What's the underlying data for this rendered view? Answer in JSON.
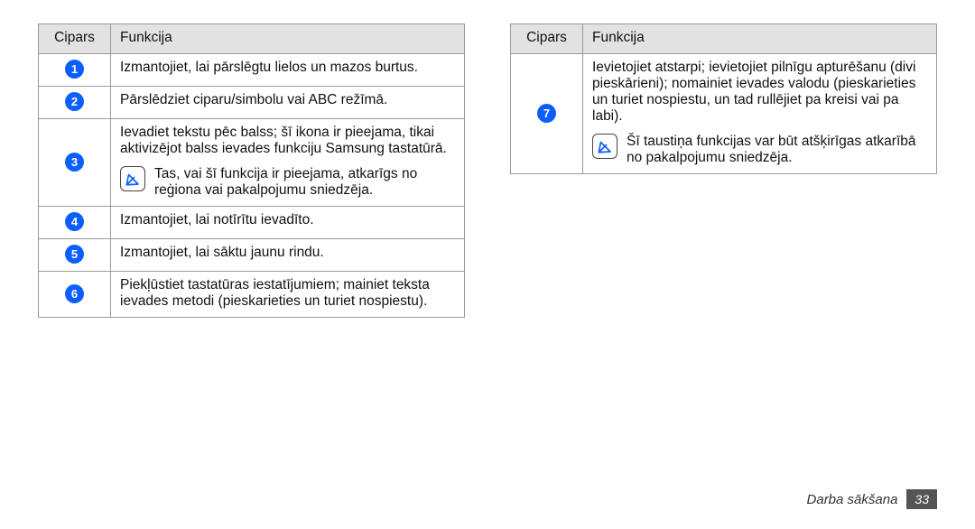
{
  "headers": {
    "num": "Cipars",
    "func": "Funkcija"
  },
  "leftRows": [
    {
      "n": "1",
      "body": "Izmantojiet, lai pārslēgtu lielos un mazos burtus."
    },
    {
      "n": "2",
      "body": "Pārslēdziet ciparu/simbolu vai ABC režīmā."
    },
    {
      "n": "3",
      "body": "Ievadiet tekstu pēc balss; šī ikona ir pieejama, tikai aktivizējot balss ievades funkciju Samsung tastatūrā.",
      "note": "Tas, vai šī funkcija ir pieejama, atkarīgs no reģiona vai pakalpojumu sniedzēja."
    },
    {
      "n": "4",
      "body": "Izmantojiet, lai notīrītu ievadīto."
    },
    {
      "n": "5",
      "body": "Izmantojiet, lai sāktu jaunu rindu."
    },
    {
      "n": "6",
      "body": "Piekļūstiet tastatūras iestatījumiem; mainiet teksta ievades metodi (pieskarieties un turiet nospiestu)."
    }
  ],
  "rightRows": [
    {
      "n": "7",
      "body": "Ievietojiet atstarpi; ievietojiet pilnīgu apturēšanu (divi pieskārieni); nomainiet ievades valodu (pieskarieties un turiet nospiestu, un tad rullējiet pa kreisi vai pa labi).",
      "note": "Šī taustiņa funkcijas var būt atšķirīgas atkarībā no pakalpojumu sniedzēja."
    }
  ],
  "footer": {
    "label": "Darba sākšana",
    "page": "33"
  }
}
